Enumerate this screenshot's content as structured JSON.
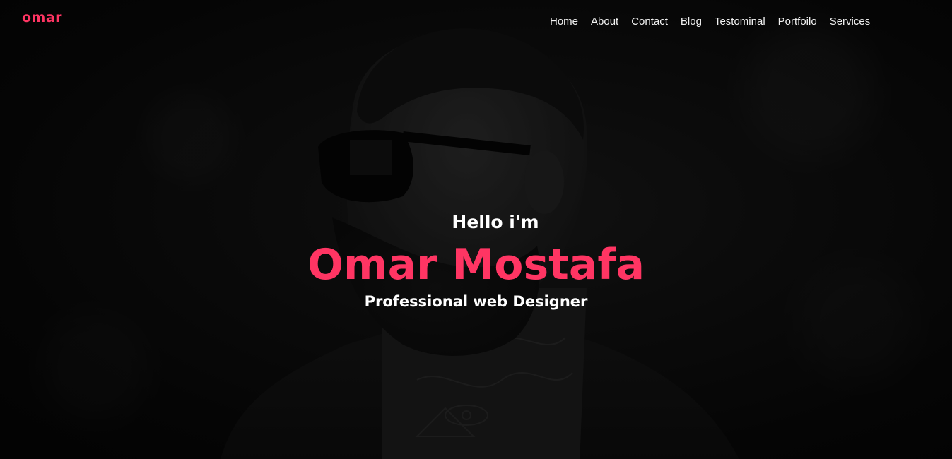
{
  "navbar": {
    "logo": "omar",
    "links": [
      {
        "label": "Home"
      },
      {
        "label": "About"
      },
      {
        "label": "Contact"
      },
      {
        "label": "Blog"
      },
      {
        "label": "Testominal"
      },
      {
        "label": "Portfoilo"
      },
      {
        "label": "Services"
      }
    ]
  },
  "hero": {
    "greeting": "Hello i'm",
    "name": "Omar Mostafa",
    "role": "Professional web Designer",
    "background_image": "portrait-photo"
  },
  "colors": {
    "accent": "#ff3563",
    "text": "#ffffff",
    "background": "#0b0b0b"
  }
}
